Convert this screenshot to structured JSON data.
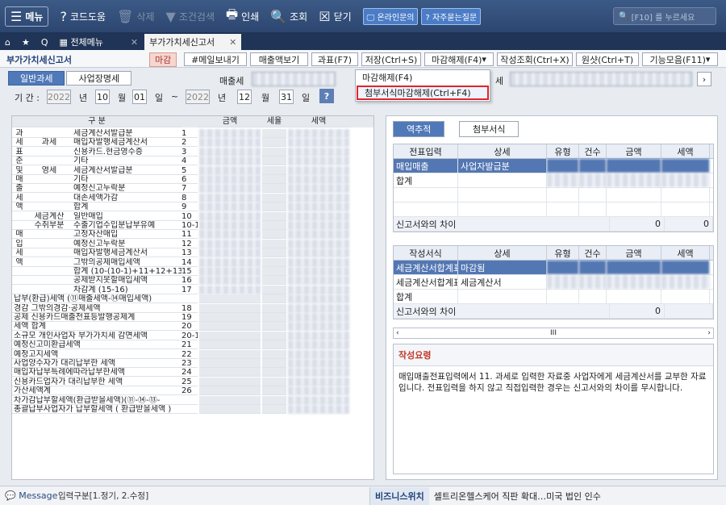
{
  "toolbar": {
    "menu": "메뉴",
    "codehelp": "코드도움",
    "delete": "삭제",
    "condsearch": "조건검색",
    "print": "인쇄",
    "query": "조회",
    "close": "닫기",
    "online": "온라인문의",
    "faq": "자주묻는질문",
    "search_placeholder": "[F10] 를 누르세요"
  },
  "tabs": {
    "all_menu": "전체메뉴",
    "vat": "부가가치세신고서"
  },
  "header": {
    "title": "부가가치세신고서",
    "badge": "마감",
    "buttons": [
      "#메일보내기",
      "매출액보기",
      "과표(F7)",
      "저장(Ctrl+S)",
      "마감해제(F4)",
      "작성조회(Ctrl+X)",
      "원샷(Ctrl+T)",
      "기능모음(F11)"
    ]
  },
  "dropdown": {
    "item1": "마감해제(F4)",
    "item2": "첨부서식마감해제(Ctrl+F4)"
  },
  "subtabs": [
    "일반과세",
    "사업장명세"
  ],
  "period": {
    "label": "기 간 :",
    "y1": "2022",
    "y_lbl": "년",
    "m1": "10",
    "m_lbl": "월",
    "d1": "01",
    "d_lbl": "일",
    "tilde": "~",
    "y2": "2022",
    "m2": "12",
    "d2": "31",
    "sales_lbl": "매출세",
    "tax_lbl": "세"
  },
  "grid_header": {
    "div": "구 분",
    "amt": "금액",
    "rate": "세율",
    "tax": "세액"
  },
  "grid_rows": [
    {
      "a": "과",
      "b": "",
      "c": "세금계산서발급분",
      "n": "1"
    },
    {
      "a": "세",
      "b": "과세",
      "c": "매입자발행세금계산서",
      "n": "2"
    },
    {
      "a": "표",
      "b": "",
      "c": "신용카드.현금영수증",
      "n": "3"
    },
    {
      "a": "준",
      "b": "",
      "c": "기타",
      "n": "4"
    },
    {
      "a": "및",
      "b": "영세",
      "c": "세금계산서발급분",
      "n": "5"
    },
    {
      "a": "매",
      "b": "",
      "c": "기타",
      "n": "6"
    },
    {
      "a": "출",
      "b": "",
      "c": "예정신고누락분",
      "n": "7"
    },
    {
      "a": "세",
      "b": "",
      "c": "대손세액가감",
      "n": "8"
    },
    {
      "a": "액",
      "b": "",
      "c": "합계",
      "n": "9"
    },
    {
      "a": "",
      "b": "세금계산",
      "c": "일반매입",
      "n": "10"
    },
    {
      "a": "",
      "b": "수취부분",
      "c": "수출기업수입분납부유예",
      "n": "10-1"
    },
    {
      "a": "매",
      "b": "",
      "c": "고정자산매입",
      "n": "11"
    },
    {
      "a": "입",
      "b": "",
      "c": "예정신고누락분",
      "n": "12"
    },
    {
      "a": "세",
      "b": "",
      "c": "매입자발행세금계산서",
      "n": "13"
    },
    {
      "a": "액",
      "b": "",
      "c": "그밖의공제매입세액",
      "n": "14"
    },
    {
      "a": "",
      "b": "",
      "c": "합계 (10-(10-1)+11+12+13+14)",
      "n": "15"
    },
    {
      "a": "",
      "b": "",
      "c": "공제받지못할매입세액",
      "n": "16"
    },
    {
      "a": "",
      "b": "",
      "c": "차감계 (15-16)",
      "n": "17"
    }
  ],
  "grid_rows2": [
    {
      "t": "납부(환급)세액 (⑪매출세액-⑭매입세액)",
      "n": ""
    },
    {
      "t": "경감  그밖의경감·공제세액",
      "n": "18"
    },
    {
      "t": "공제  신용카드매출전표등발행공제계",
      "n": "19"
    },
    {
      "t": "세액  합계",
      "n": "20"
    },
    {
      "t": "소규모 개인사업자 부가가치세 감면세액",
      "n": "20-1"
    },
    {
      "t": "예정신고미환급세액",
      "n": "21"
    },
    {
      "t": "예정고지세액",
      "n": "22"
    },
    {
      "t": "사업양수자가 대리납부한 세액",
      "n": "23"
    },
    {
      "t": "매입자납부특례에따라납부한세액",
      "n": "24"
    },
    {
      "t": "신용카드업자가 대리납부한 세액",
      "n": "25"
    },
    {
      "t": "가산세액계",
      "n": "26"
    },
    {
      "t": "차가감납부할세액(환급받을세액)(⑪-⑭-⑬-",
      "n": ""
    },
    {
      "t": "총괄납부사업자가 납부할세액 ( 환급받을세액 )",
      "n": ""
    }
  ],
  "right": {
    "tabs": [
      "역추적",
      "첨부서식"
    ],
    "t1_headers": [
      "전표입력",
      "상세",
      "유형",
      "건수",
      "금액",
      "세액"
    ],
    "t1_rows": [
      [
        "매입매출",
        "사업자발급분",
        "",
        "",
        "",
        ""
      ],
      [
        "합계",
        "",
        "",
        "",
        "",
        ""
      ],
      [
        "",
        "",
        "",
        "",
        "",
        ""
      ],
      [
        "",
        "",
        "",
        "",
        "",
        ""
      ]
    ],
    "t1_diff": "신고서와의 차이",
    "t1_diff_amt": "0",
    "t1_diff_tax": "0",
    "t2_headers": [
      "작성서식",
      "상세",
      "유형",
      "건수",
      "금액",
      "세액"
    ],
    "t2_rows": [
      [
        "세금계산서합계표",
        "마감됨",
        "",
        "",
        "",
        ""
      ],
      [
        "세금계산서합계표",
        "세금계산서",
        "",
        "",
        "",
        ""
      ],
      [
        "합계",
        "",
        "",
        "",
        "",
        ""
      ]
    ],
    "t2_diff": "신고서와의 차이",
    "t2_diff_amt": "0",
    "scroll_mid": "III",
    "note_title": "작성요령",
    "note_body": "매입매출전표입력에서 11. 과세로 입력한 자료중 사업자에게 세금계산서를 교부한 자료입니다. 전표입력을 하지 않고 직접입력한 경우는 신고서와의 차이를 무시합니다."
  },
  "status": {
    "message": "Message",
    "input": "입력구분[1.정기, 2.수정]",
    "biz": "비즈니스위치",
    "news": "셀트리온헬스케어 직판 확대…미국 법인 인수"
  }
}
